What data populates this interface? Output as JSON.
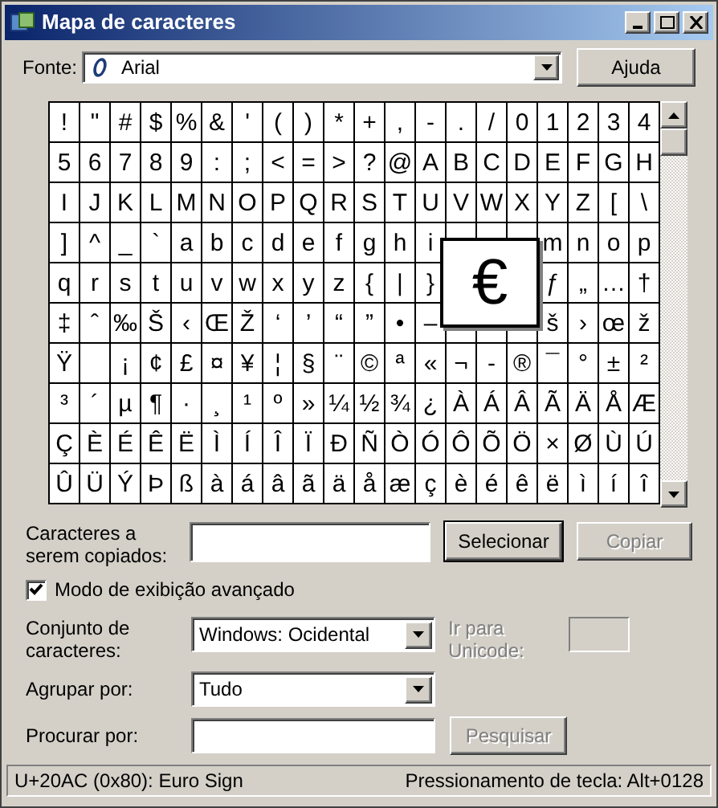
{
  "window": {
    "title": "Mapa de caracteres"
  },
  "font": {
    "label": "Fonte:",
    "value": "Arial"
  },
  "help_button": "Ajuda",
  "grid": {
    "rows": [
      [
        "!",
        "\"",
        "#",
        "$",
        "%",
        "&",
        "'",
        "(",
        ")",
        "*",
        "+",
        ",",
        "-",
        ".",
        "/",
        "0",
        "1",
        "2",
        "3",
        "4"
      ],
      [
        "5",
        "6",
        "7",
        "8",
        "9",
        ":",
        ";",
        "<",
        "=",
        ">",
        "?",
        "@",
        "A",
        "B",
        "C",
        "D",
        "E",
        "F",
        "G",
        "H"
      ],
      [
        "I",
        "J",
        "K",
        "L",
        "M",
        "N",
        "O",
        "P",
        "Q",
        "R",
        "S",
        "T",
        "U",
        "V",
        "W",
        "X",
        "Y",
        "Z",
        "[",
        "\\"
      ],
      [
        "]",
        "^",
        "_",
        "`",
        "a",
        "b",
        "c",
        "d",
        "e",
        "f",
        "g",
        "h",
        "i",
        null,
        null,
        null,
        "m",
        "n",
        "o",
        "p"
      ],
      [
        "q",
        "r",
        "s",
        "t",
        "u",
        "v",
        "w",
        "x",
        "y",
        "z",
        "{",
        "|",
        "}",
        null,
        null,
        null,
        "ƒ",
        "„",
        "…",
        "†"
      ],
      [
        "‡",
        "ˆ",
        "‰",
        "Š",
        "‹",
        "Œ",
        "Ž",
        "‘",
        "’",
        "“",
        "”",
        "•",
        "–",
        null,
        null,
        null,
        "š",
        "›",
        "œ",
        "ž"
      ],
      [
        "Ÿ",
        null,
        "¡",
        "¢",
        "£",
        "¤",
        "¥",
        "¦",
        "§",
        "¨",
        "©",
        "ª",
        "«",
        "¬",
        "-",
        "®",
        "¯",
        "°",
        "±",
        "²"
      ],
      [
        "³",
        "´",
        "µ",
        "¶",
        "·",
        "¸",
        "¹",
        "º",
        "»",
        "¼",
        "½",
        "¾",
        "¿",
        "À",
        "Á",
        "Â",
        "Ã",
        "Ä",
        "Å",
        "Æ"
      ],
      [
        "Ç",
        "È",
        "É",
        "Ê",
        "Ë",
        "Ì",
        "Í",
        "Î",
        "Ï",
        "Ð",
        "Ñ",
        "Ò",
        "Ó",
        "Ô",
        "Õ",
        "Ö",
        "×",
        "Ø",
        "Ù",
        "Ú"
      ],
      [
        "Û",
        "Ü",
        "Ý",
        "Þ",
        "ß",
        "à",
        "á",
        "â",
        "ã",
        "ä",
        "å",
        "æ",
        "ç",
        "è",
        "é",
        "ê",
        "ë",
        "ì",
        "í",
        "î"
      ]
    ],
    "enlarged_character": "€"
  },
  "copy": {
    "label": "Caracteres a serem copiados:",
    "select_button": "Selecionar",
    "copy_button": {
      "label": "Copiar",
      "disabled": true
    }
  },
  "advanced": {
    "label": "Modo de exibição avançado",
    "checked": true
  },
  "charset": {
    "label": "Conjunto de caracteres:",
    "value": "Windows: Ocidental"
  },
  "goto_unicode": {
    "label": "Ir para Unicode:",
    "disabled": true
  },
  "group_by": {
    "label": "Agrupar por:",
    "value": "Tudo"
  },
  "search": {
    "label": "Procurar por:",
    "button": {
      "label": "Pesquisar",
      "disabled": true
    }
  },
  "status_bar": {
    "left": "U+20AC (0x80): Euro Sign",
    "right": "Pressionamento de tecla: Alt+0128"
  }
}
